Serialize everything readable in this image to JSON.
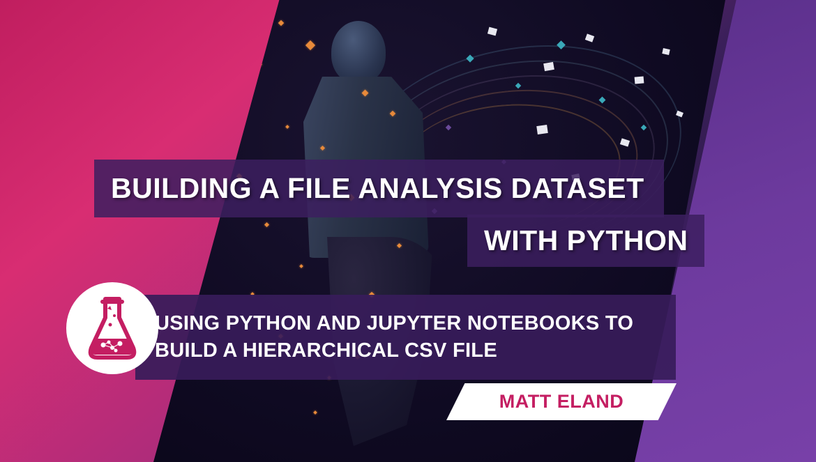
{
  "title": {
    "line1": "BUILDING A FILE ANALYSIS DATASET",
    "line2": "WITH PYTHON"
  },
  "subtitle": "USING PYTHON AND JUPYTER NOTEBOOKS TO BUILD A HIERARCHICAL CSV FILE",
  "author": "MATT ELAND",
  "logo": {
    "name": "flask-icon"
  },
  "colors": {
    "accent_pink": "#c41e62",
    "accent_purple": "#3c1e5f",
    "text_white": "#ffffff"
  }
}
